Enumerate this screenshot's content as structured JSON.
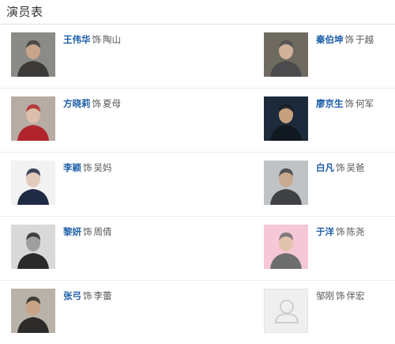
{
  "section": {
    "title": "演员表"
  },
  "cast": [
    {
      "actor": "王伟华",
      "role_prefix": "饰",
      "character": "陶山",
      "photo": "actor-photo",
      "bg": "#8a8a86",
      "fg": "#3b3a38",
      "skin": "#c8a48a"
    },
    {
      "actor": "秦伯坤",
      "role_prefix": "饰",
      "character": "于越",
      "photo": "actor-photo",
      "bg": "#6f6a60",
      "fg": "#4b4a4d",
      "skin": "#d2b39a"
    },
    {
      "actor": "方晓莉",
      "role_prefix": "饰",
      "character": "夏母",
      "photo": "actor-photo",
      "bg": "#b7aca4",
      "fg": "#b0242b",
      "skin": "#dcbfaa"
    },
    {
      "actor": "廖京生",
      "role_prefix": "饰",
      "character": "何军",
      "photo": "actor-photo",
      "bg": "#1c2a3b",
      "fg": "#101820",
      "skin": "#c9a07f"
    },
    {
      "actor": "李颖",
      "role_prefix": "饰",
      "character": "吴妈",
      "photo": "actor-photo",
      "bg": "#f2f2f2",
      "fg": "#1f2a44",
      "skin": "#e3cbbb"
    },
    {
      "actor": "白凡",
      "role_prefix": "饰",
      "character": "吴爸",
      "photo": "actor-photo",
      "bg": "#bfc3c6",
      "fg": "#3f4144",
      "skin": "#caa98f"
    },
    {
      "actor": "黎妍",
      "role_prefix": "饰",
      "character": "周倩",
      "photo": "actor-photo",
      "bg": "#d9d9d9",
      "fg": "#2a2a2a",
      "skin": "#9f9f9f"
    },
    {
      "actor": "于洋",
      "role_prefix": "饰",
      "character": "陈尧",
      "photo": "actor-photo",
      "bg": "#f6c7d6",
      "fg": "#6d6f6e",
      "skin": "#e2c4ad"
    },
    {
      "actor": "张弓",
      "role_prefix": "饰",
      "character": "李蕾",
      "photo": "actor-photo",
      "bg": "#b9b2a8",
      "fg": "#2e2c2a",
      "skin": "#c9a486"
    },
    {
      "actor": "邹刚",
      "role_prefix": "饰",
      "character": "伴宏",
      "photo": "placeholder-avatar",
      "bg": "#efefef",
      "fg": "#cfcfcf",
      "skin": "#cfcfcf",
      "linked": false
    }
  ]
}
